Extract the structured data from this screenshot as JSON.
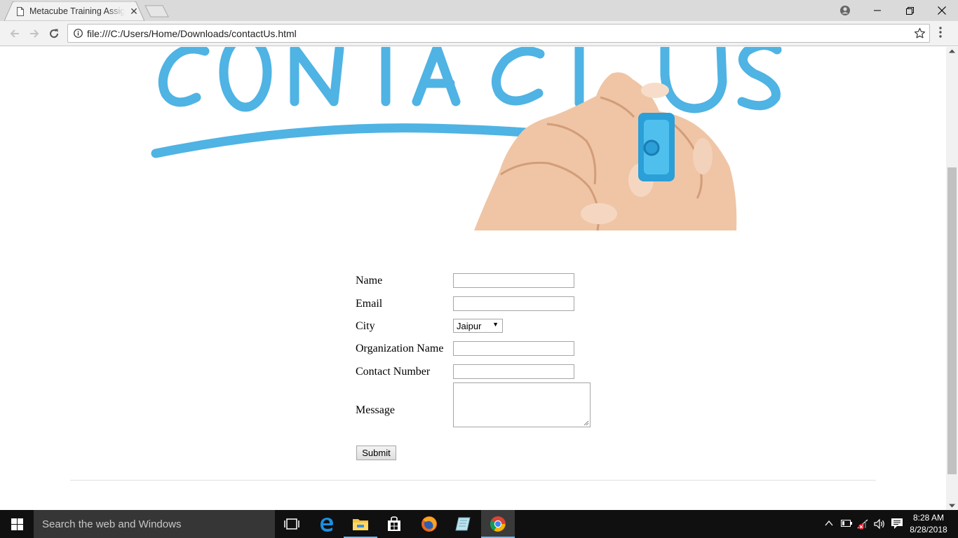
{
  "browser": {
    "tab_title": "Metacube Training Assignment",
    "url": "file:///C:/Users/Home/Downloads/contactUs.html"
  },
  "hero": {
    "alt_text": "CONTACT US"
  },
  "form": {
    "fields": [
      {
        "label": "Name",
        "type": "text",
        "value": ""
      },
      {
        "label": "Email",
        "type": "text",
        "value": ""
      },
      {
        "label": "City",
        "type": "select",
        "value": "Jaipur"
      },
      {
        "label": "Organization Name",
        "type": "text",
        "value": ""
      },
      {
        "label": "Contact Number",
        "type": "text",
        "value": ""
      },
      {
        "label": "Message",
        "type": "textarea",
        "value": ""
      }
    ],
    "submit_label": "Submit"
  },
  "taskbar": {
    "search_placeholder": "Search the web and Windows",
    "apps": [
      "task-view-icon",
      "edge-icon",
      "file-explorer-icon",
      "store-icon",
      "firefox-icon",
      "notepad-icon",
      "chrome-icon"
    ],
    "time": "8:28 AM",
    "date": "8/28/2018"
  },
  "colors": {
    "accent_blue": "#4fb3e4",
    "taskbar": "#101010",
    "tabstrip": "#dadada"
  }
}
